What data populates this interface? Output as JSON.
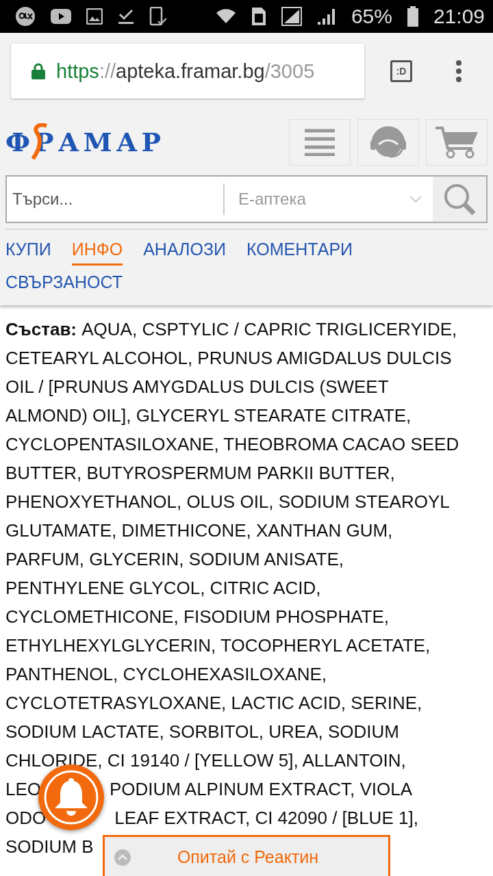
{
  "status_bar": {
    "battery": "65%",
    "time": "21:09"
  },
  "browser": {
    "url_scheme": "https",
    "url_separator": "://",
    "url_host": "apteka.framar.bg",
    "url_path": "/3005",
    "tab_switcher": ":D"
  },
  "site": {
    "logo": "ФРАМАР",
    "search": {
      "placeholder": "Търси...",
      "category": "Е-аптека"
    },
    "tabs": [
      {
        "label": "КУПИ",
        "selected": false
      },
      {
        "label": "ИНФО",
        "selected": true
      },
      {
        "label": "АНАЛОЗИ",
        "selected": false
      },
      {
        "label": "КОМЕНТАРИ",
        "selected": false
      },
      {
        "label": "СВЪРЗАНОСТ",
        "selected": false
      }
    ]
  },
  "ingredients": {
    "lines": [
      {
        "segments": [
          "**Състав:** AQUA, CSPTYLIC / CAPRIC TRIGLICERYIDE,"
        ]
      },
      {
        "segments": [
          "CETEARYL ALCOHOL, PRUNUS AMIGDALUS DULCIS"
        ]
      },
      {
        "segments": [
          "OIL / [PRUNUS AMYGDALUS DULCIS (SWEET"
        ]
      },
      {
        "segments": [
          "ALMOND) OIL], GLYCERYL STEARATE CITRATE,"
        ]
      },
      {
        "segments": [
          "CYCLOPENTASILOXANE, THEOBROMA CACAO SEED"
        ]
      },
      {
        "segments": [
          "BUTTER, BUTYROSPERMUM PARKII BUTTER,"
        ]
      },
      {
        "segments": [
          "PHENOXYETHANOL, OLUS OIL, SODIUM STEAROYL"
        ]
      },
      {
        "segments": [
          "GLUTAMATE, DIMETHICONE, XANTHAN GUM,"
        ]
      },
      {
        "segments": [
          "PARFUM, GLYCERIN, SODIUM ANISATE,"
        ]
      },
      {
        "segments": [
          "PENTHYLENE GLYCOL, CITRIC ACID,"
        ]
      },
      {
        "segments": [
          "CYCLOMETHICONE, FISODIUM PHOSPHATE,"
        ]
      },
      {
        "segments": [
          "ETHYLHEXYLGLYCERIN, TOCOPHERYL ACETATE,"
        ]
      },
      {
        "segments": [
          "PANTHENOL, CYCLOHEXASILOXANE,"
        ]
      },
      {
        "segments": [
          "CYCLOTETRASYLOXANE, LACTIC ACID, SERINE,"
        ]
      },
      {
        "segments": [
          "SODIUM LACTATE, SORBITOL, UREA, SODIUM"
        ]
      },
      {
        "segments": [
          "CHLORIDE, CI 19140 / [YELLOW 5], ALLANTOIN,"
        ]
      },
      {
        "segments": [
          "LEO",
          "PODIUM ALPINUM EXTRACT, VIOLA"
        ]
      },
      {
        "segments": [
          "ODO",
          "LEAF EXTRACT, CI 42090 / [BLUE 1],"
        ]
      },
      {
        "segments": [
          "SODIUM B"
        ]
      }
    ]
  },
  "chat_bar": {
    "label": "Опитай с Реактин"
  }
}
